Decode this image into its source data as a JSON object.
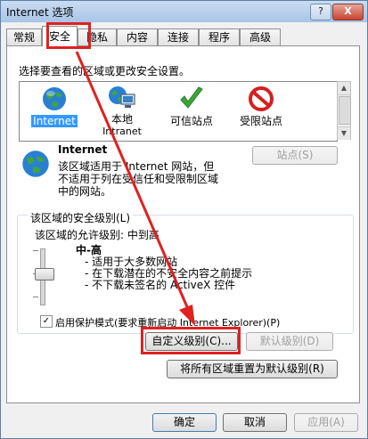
{
  "window": {
    "title": "Internet 选项",
    "help_label": "?",
    "close_label": "X"
  },
  "tabs": [
    {
      "label": "常规"
    },
    {
      "label": "安全"
    },
    {
      "label": "隐私"
    },
    {
      "label": "内容"
    },
    {
      "label": "连接"
    },
    {
      "label": "程序"
    },
    {
      "label": "高级"
    }
  ],
  "active_tab": "安全",
  "security": {
    "zone_prompt": "选择要查看的区域或更改安全设置。",
    "zones": [
      {
        "label": "Internet",
        "label2": "",
        "icon": "globe-icon"
      },
      {
        "label": "本地",
        "label2": "Intranet",
        "icon": "local-intranet-icon"
      },
      {
        "label": "可信站点",
        "label2": "",
        "icon": "checkmark-icon"
      },
      {
        "label": "受限站点",
        "label2": "",
        "icon": "restricted-icon"
      }
    ],
    "selected_zone": {
      "name": "Internet",
      "description_lines": [
        "该区域适用于 Internet 网站，但",
        "不适用于列在受信任和受限制区域",
        "中的网站。"
      ],
      "sites_button": "站点(S)"
    },
    "level_group": {
      "title": "该区域的安全级别(L)",
      "allowed_levels": "该区域的允许级别: 中到高",
      "level_name": "中-高",
      "bullets": [
        "- 适用于大多数网站",
        "- 在下载潜在的不安全内容之前提示",
        "- 不下载未签名的 ActiveX 控件"
      ],
      "protected_mode": "启用保护模式(要求重新启动 Internet Explorer)(P)",
      "protected_mode_checked": true,
      "custom_button": "自定义级别(C)...",
      "default_button": "默认级别(D)"
    },
    "reset_all_button": "将所有区域重置为默认级别(R)"
  },
  "footer": {
    "ok": "确定",
    "cancel": "取消",
    "apply": "应用(A)"
  }
}
